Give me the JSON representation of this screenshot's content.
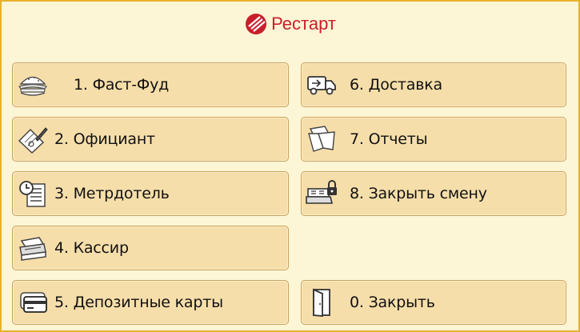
{
  "app": {
    "title": "Рестарт"
  },
  "buttons": [
    {
      "label": "1. Фаст-Фуд",
      "icon": "burger-icon"
    },
    {
      "label": "2. Официант",
      "icon": "order-pad-icon"
    },
    {
      "label": "3. Метрдотель",
      "icon": "schedule-icon"
    },
    {
      "label": "4. Кассир",
      "icon": "cash-register-icon"
    },
    {
      "label": "5. Депозитные карты",
      "icon": "card-icon"
    },
    {
      "label": "6. Доставка",
      "icon": "truck-icon"
    },
    {
      "label": "7. Отчеты",
      "icon": "reports-folder-icon"
    },
    {
      "label": "8. Закрыть смену",
      "icon": "register-lock-icon"
    },
    {
      "label": "0. Закрыть",
      "icon": "door-icon"
    }
  ],
  "colors": {
    "brand": "#c8202b",
    "button_bg": "#f6deaa",
    "border": "#e8b22e"
  }
}
